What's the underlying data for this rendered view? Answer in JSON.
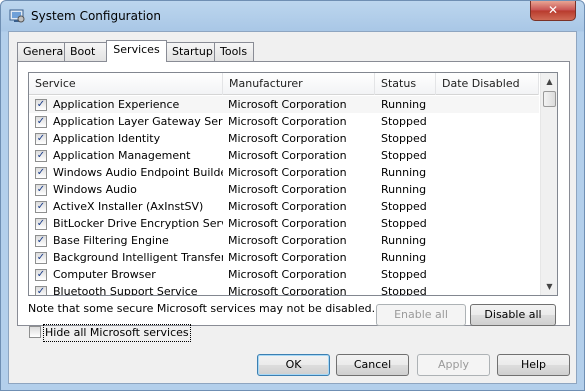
{
  "window": {
    "title": "System Configuration",
    "close_glyph": "✕"
  },
  "tabs": [
    {
      "label": "General"
    },
    {
      "label": "Boot"
    },
    {
      "label": "Services",
      "active": true
    },
    {
      "label": "Startup"
    },
    {
      "label": "Tools"
    }
  ],
  "services": {
    "columns": [
      "Service",
      "Manufacturer",
      "Status",
      "Date Disabled"
    ],
    "rows": [
      {
        "checked": true,
        "service": "Application Experience",
        "manufacturer": "Microsoft Corporation",
        "status": "Running",
        "date_disabled": ""
      },
      {
        "checked": true,
        "service": "Application Layer Gateway Service",
        "manufacturer": "Microsoft Corporation",
        "status": "Stopped",
        "date_disabled": ""
      },
      {
        "checked": true,
        "service": "Application Identity",
        "manufacturer": "Microsoft Corporation",
        "status": "Stopped",
        "date_disabled": ""
      },
      {
        "checked": true,
        "service": "Application Management",
        "manufacturer": "Microsoft Corporation",
        "status": "Stopped",
        "date_disabled": ""
      },
      {
        "checked": true,
        "service": "Windows Audio Endpoint Builder",
        "manufacturer": "Microsoft Corporation",
        "status": "Running",
        "date_disabled": ""
      },
      {
        "checked": true,
        "service": "Windows Audio",
        "manufacturer": "Microsoft Corporation",
        "status": "Running",
        "date_disabled": ""
      },
      {
        "checked": true,
        "service": "ActiveX Installer (AxInstSV)",
        "manufacturer": "Microsoft Corporation",
        "status": "Stopped",
        "date_disabled": ""
      },
      {
        "checked": true,
        "service": "BitLocker Drive Encryption Service",
        "manufacturer": "Microsoft Corporation",
        "status": "Stopped",
        "date_disabled": ""
      },
      {
        "checked": true,
        "service": "Base Filtering Engine",
        "manufacturer": "Microsoft Corporation",
        "status": "Running",
        "date_disabled": ""
      },
      {
        "checked": true,
        "service": "Background Intelligent Transfer ...",
        "manufacturer": "Microsoft Corporation",
        "status": "Running",
        "date_disabled": ""
      },
      {
        "checked": true,
        "service": "Computer Browser",
        "manufacturer": "Microsoft Corporation",
        "status": "Stopped",
        "date_disabled": ""
      },
      {
        "checked": true,
        "service": "Bluetooth Support Service",
        "manufacturer": "Microsoft Corporation",
        "status": "Stopped",
        "date_disabled": ""
      }
    ],
    "checkmark": "✓",
    "scroll_up_glyph": "▲",
    "scroll_down_glyph": "▼"
  },
  "note": "Note that some secure Microsoft services may not be disabled.",
  "buttons": {
    "enable_all": "Enable all",
    "disable_all": "Disable all",
    "ok": "OK",
    "cancel": "Cancel",
    "apply": "Apply",
    "help": "Help"
  },
  "hide_ms": {
    "label": "Hide all Microsoft services",
    "checked": false
  }
}
